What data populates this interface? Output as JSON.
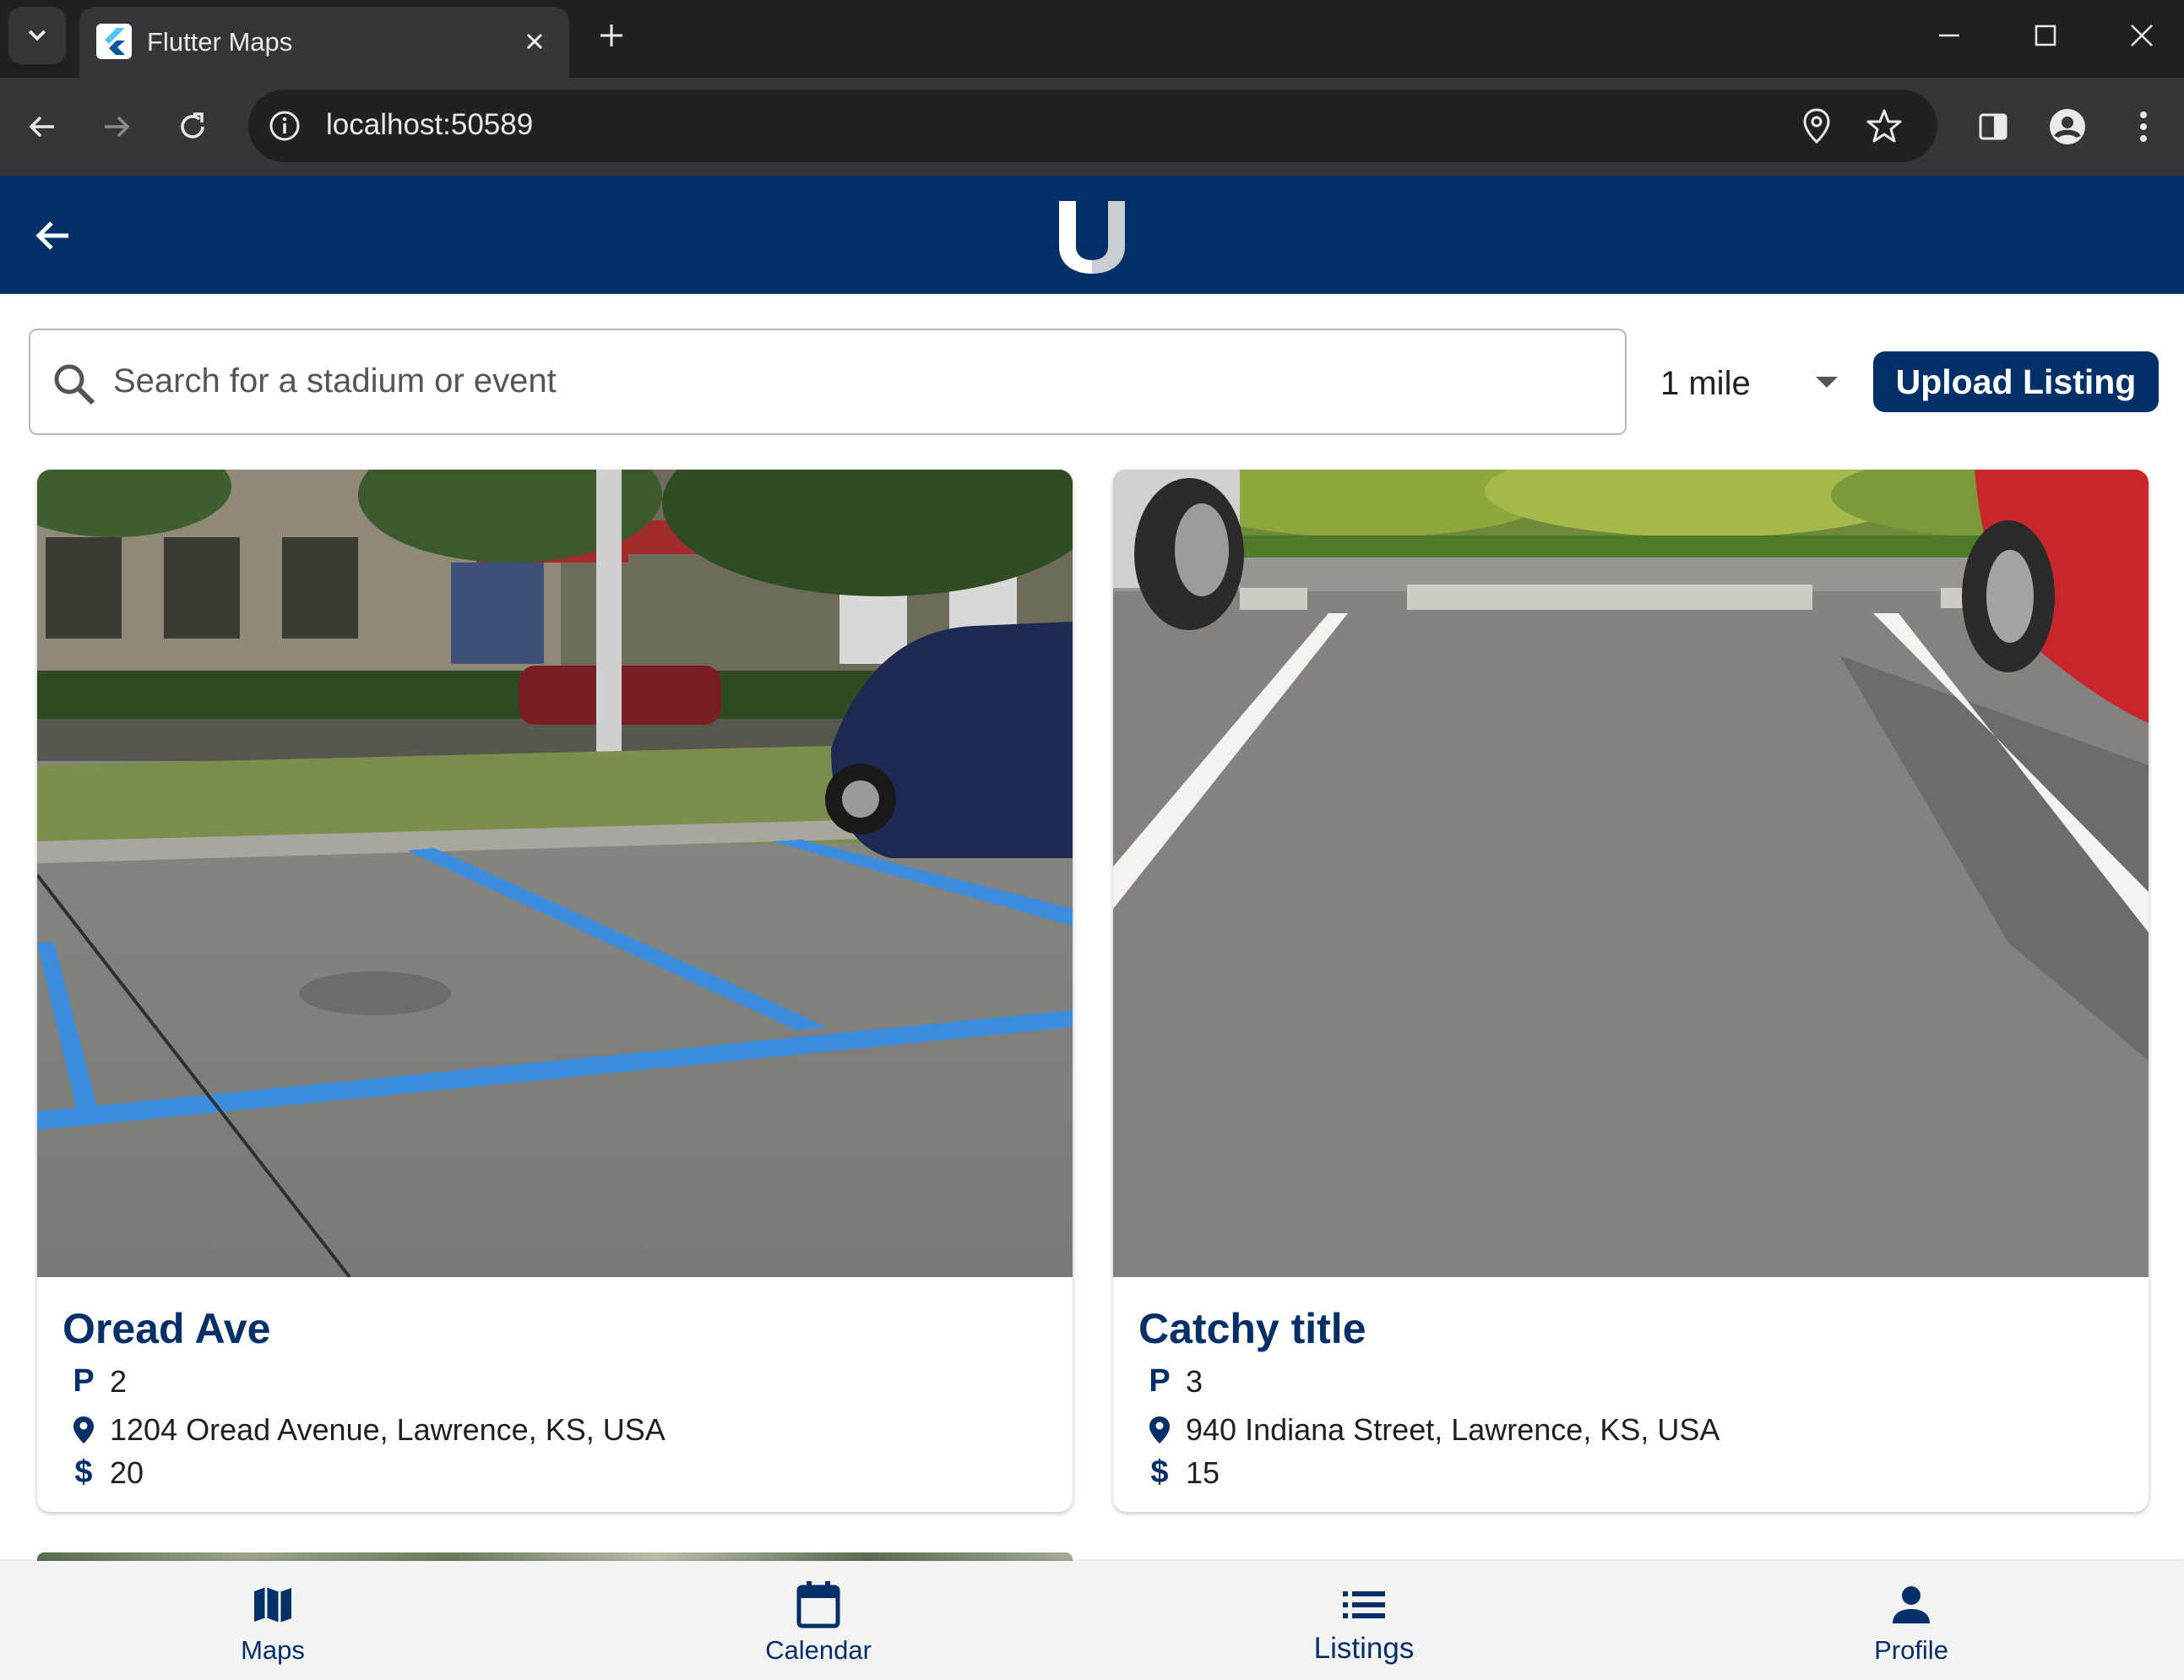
{
  "browser": {
    "tab_title": "Flutter Maps",
    "url": "localhost:50589"
  },
  "search": {
    "placeholder": "Search for a stadium or event",
    "value": ""
  },
  "radius": {
    "selected": "1 mile"
  },
  "upload_label": "Upload Listing",
  "listings": [
    {
      "title": "Oread Ave",
      "spots": "2",
      "address": "1204 Oread Avenue, Lawrence, KS, USA",
      "price": "20"
    },
    {
      "title": "Catchy title",
      "spots": "3",
      "address": "940 Indiana Street, Lawrence, KS, USA",
      "price": "15"
    }
  ],
  "icons": {
    "spots": "P",
    "price": "$"
  },
  "nav": {
    "maps": "Maps",
    "calendar": "Calendar",
    "listings": "Listings",
    "profile": "Profile"
  },
  "colors": {
    "brand": "#013068",
    "chrome_dark": "#202124",
    "chrome_mid": "#35363a"
  }
}
